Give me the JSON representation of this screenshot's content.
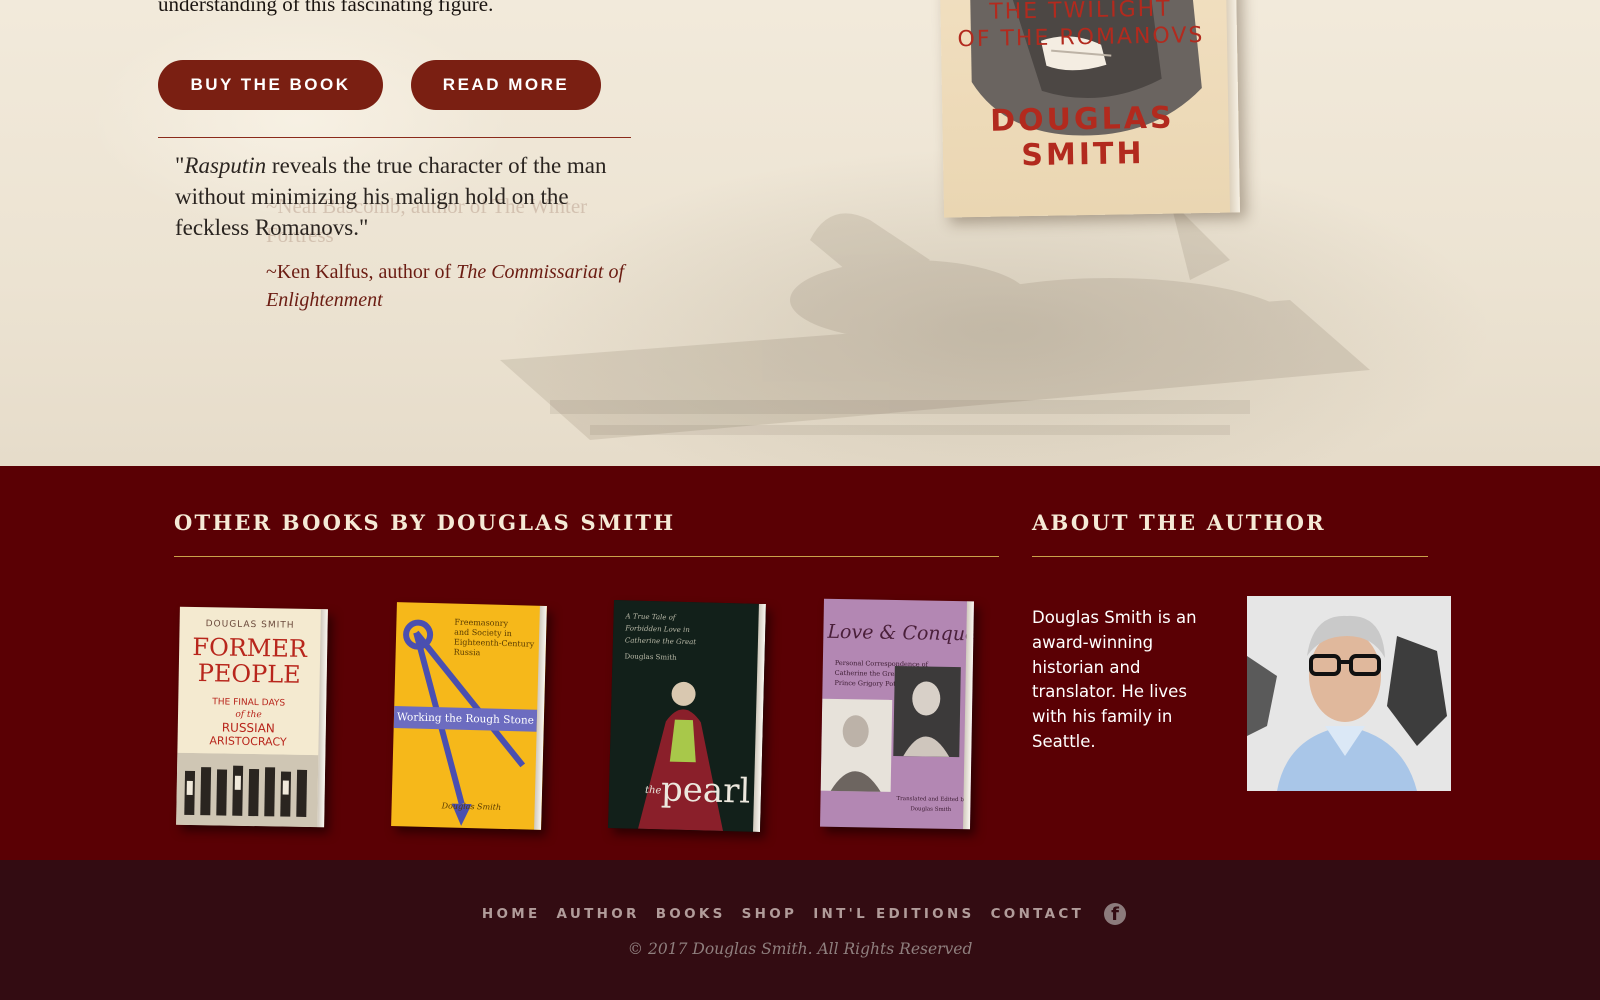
{
  "hero": {
    "intro_tail": "understanding of this fascinating figure.",
    "buy_label": "BUY THE BOOK",
    "read_label": "READ MORE",
    "quote_open": "\"",
    "quote_title": "Rasputin",
    "quote_rest": " reveals the true character of the man without minimizing his malign hold on the feckless Romanovs.\"",
    "ghost_quote": "~Neal Bascomb, author of The Winter Fortress",
    "attribution_prefix": "~Ken Kalfus, author of ",
    "attribution_title": "The Commissariat of Enlightenment",
    "cover": {
      "subtitle_line1": "THE TWILIGHT",
      "subtitle_line2": "OF THE ROMANOVS",
      "author": "DOUGLAS SMITH"
    }
  },
  "other_books": {
    "title": "OTHER BOOKS BY DOUGLAS SMITH",
    "books": [
      {
        "author_line": "DOUGLAS SMITH",
        "title_line1": "FORMER",
        "title_line2": "PEOPLE",
        "subtitle_line1": "THE FINAL DAYS",
        "subtitle_line2": "of the",
        "subtitle_line3": "RUSSIAN",
        "subtitle_line4": "ARISTOCRACY"
      },
      {
        "top_text_line1": "Freemasonry",
        "top_text_line2": "and Society in",
        "top_text_line3": "Eighteenth-Century",
        "top_text_line4": "Russia",
        "title": "Working the Rough Stone",
        "author": "Douglas Smith"
      },
      {
        "top_line1": "A True Tale of",
        "top_line2": "Forbidden Love in",
        "top_line3": "Catherine the Great",
        "top_line4": "Douglas Smith",
        "title_the": "the",
        "title": "pearl"
      },
      {
        "title": "Love & Conquest",
        "sub_line1": "Personal Correspondence of",
        "sub_line2": "Catherine the Great and",
        "sub_line3": "Prince Grigory Potemkin",
        "edited_line1": "Translated and Edited by",
        "edited_line2": "Douglas Smith"
      }
    ]
  },
  "about": {
    "title": "ABOUT THE AUTHOR",
    "bio": "Douglas Smith is an award-winning historian and translator. He lives with his family in Seattle."
  },
  "footer": {
    "nav": [
      "HOME",
      "AUTHOR",
      "BOOKS",
      "SHOP",
      "INT'L EDITIONS",
      "CONTACT"
    ],
    "facebook_glyph": "f",
    "copyright": "© 2017 Douglas Smith. All Rights Reserved"
  },
  "colors": {
    "maroon": "#5a0004",
    "footer_bg": "#330c12",
    "button": "#7a1f12",
    "gold_rule": "#c9a24a"
  },
  "icons": [
    "facebook-icon"
  ]
}
